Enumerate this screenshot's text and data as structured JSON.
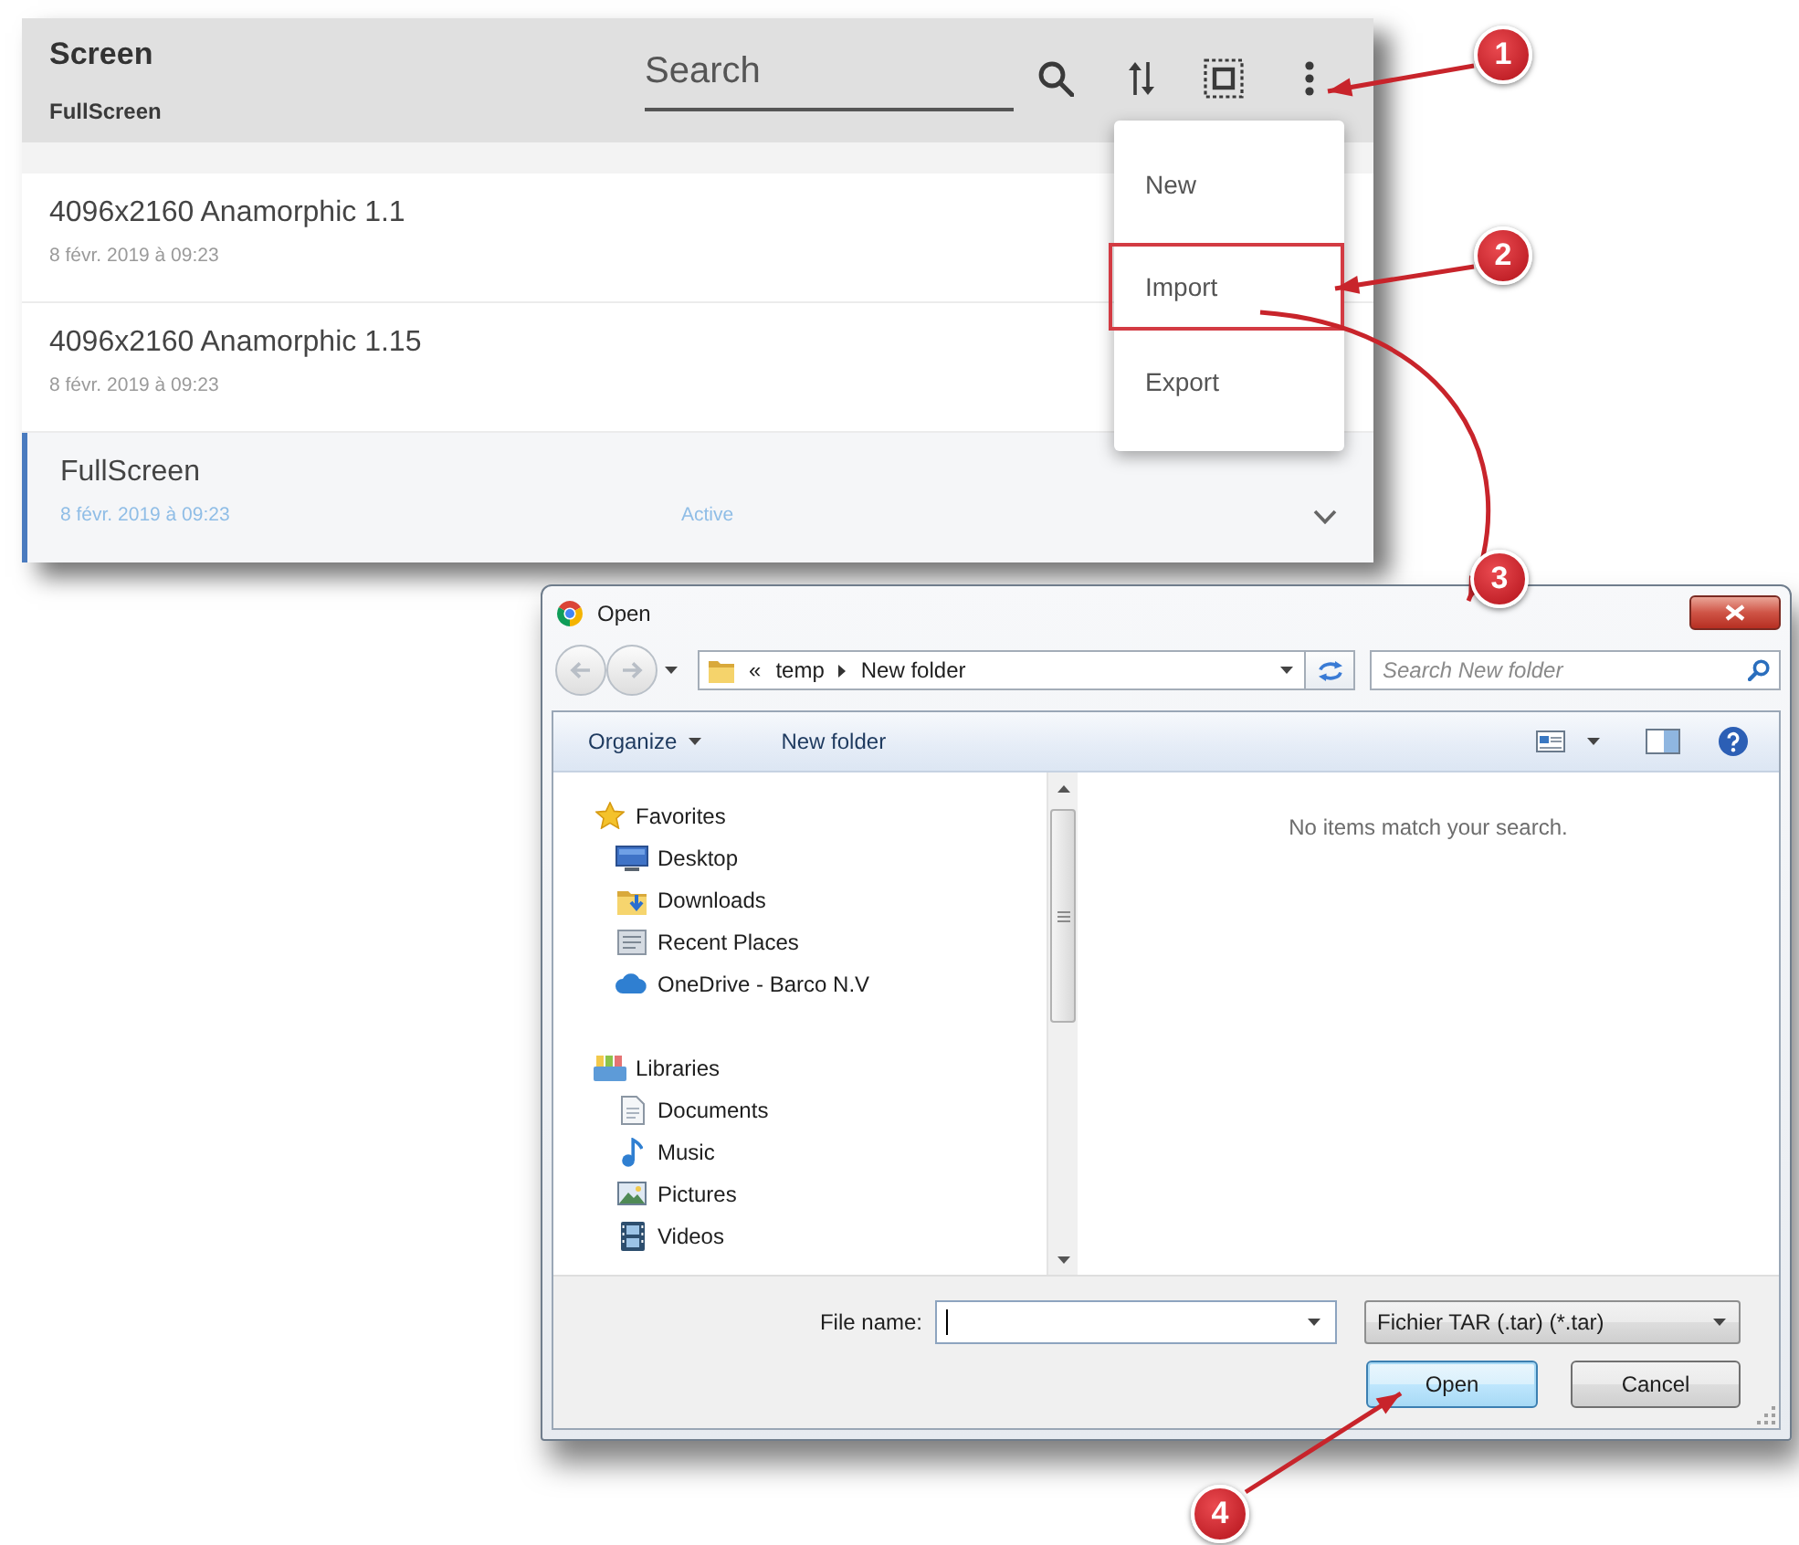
{
  "app": {
    "title": "Screen",
    "subtitle": "FullScreen",
    "search": {
      "placeholder": "Search"
    },
    "items": [
      {
        "name": "4096x2160 Anamorphic 1.1",
        "date": "8 févr. 2019 à 09:23",
        "selected": false
      },
      {
        "name": "4096x2160 Anamorphic 1.15",
        "date": "8 févr. 2019 à 09:23",
        "selected": false
      },
      {
        "name": "FullScreen",
        "date": "8 févr. 2019 à 09:23",
        "status": "Active",
        "selected": true,
        "expanded": false
      }
    ],
    "menu": [
      {
        "label": "New",
        "highlighted": false
      },
      {
        "label": "Import",
        "highlighted": true
      },
      {
        "label": "Export",
        "highlighted": false
      }
    ]
  },
  "dialog": {
    "title": "Open",
    "address": {
      "overflow": "«",
      "path": [
        "temp",
        "New folder"
      ]
    },
    "search": {
      "placeholder": "Search New folder"
    },
    "toolbar": {
      "organize": "Organize",
      "new_folder": "New folder"
    },
    "nav": [
      {
        "label": "Favorites",
        "children": [
          {
            "label": "Desktop"
          },
          {
            "label": "Downloads"
          },
          {
            "label": "Recent Places"
          },
          {
            "label": "OneDrive - Barco N.V"
          }
        ]
      },
      {
        "label": "Libraries",
        "children": [
          {
            "label": "Documents"
          },
          {
            "label": "Music"
          },
          {
            "label": "Pictures"
          },
          {
            "label": "Videos"
          }
        ]
      }
    ],
    "empty_message": "No items match your search.",
    "file_name_label": "File name:",
    "file_type": "Fichier TAR (.tar) (*.tar)",
    "buttons": [
      {
        "label": "Open",
        "kind": "default"
      },
      {
        "label": "Cancel",
        "kind": "normal"
      }
    ]
  },
  "callouts": [
    {
      "number": "1"
    },
    {
      "number": "2"
    },
    {
      "number": "3"
    },
    {
      "number": "4"
    }
  ]
}
